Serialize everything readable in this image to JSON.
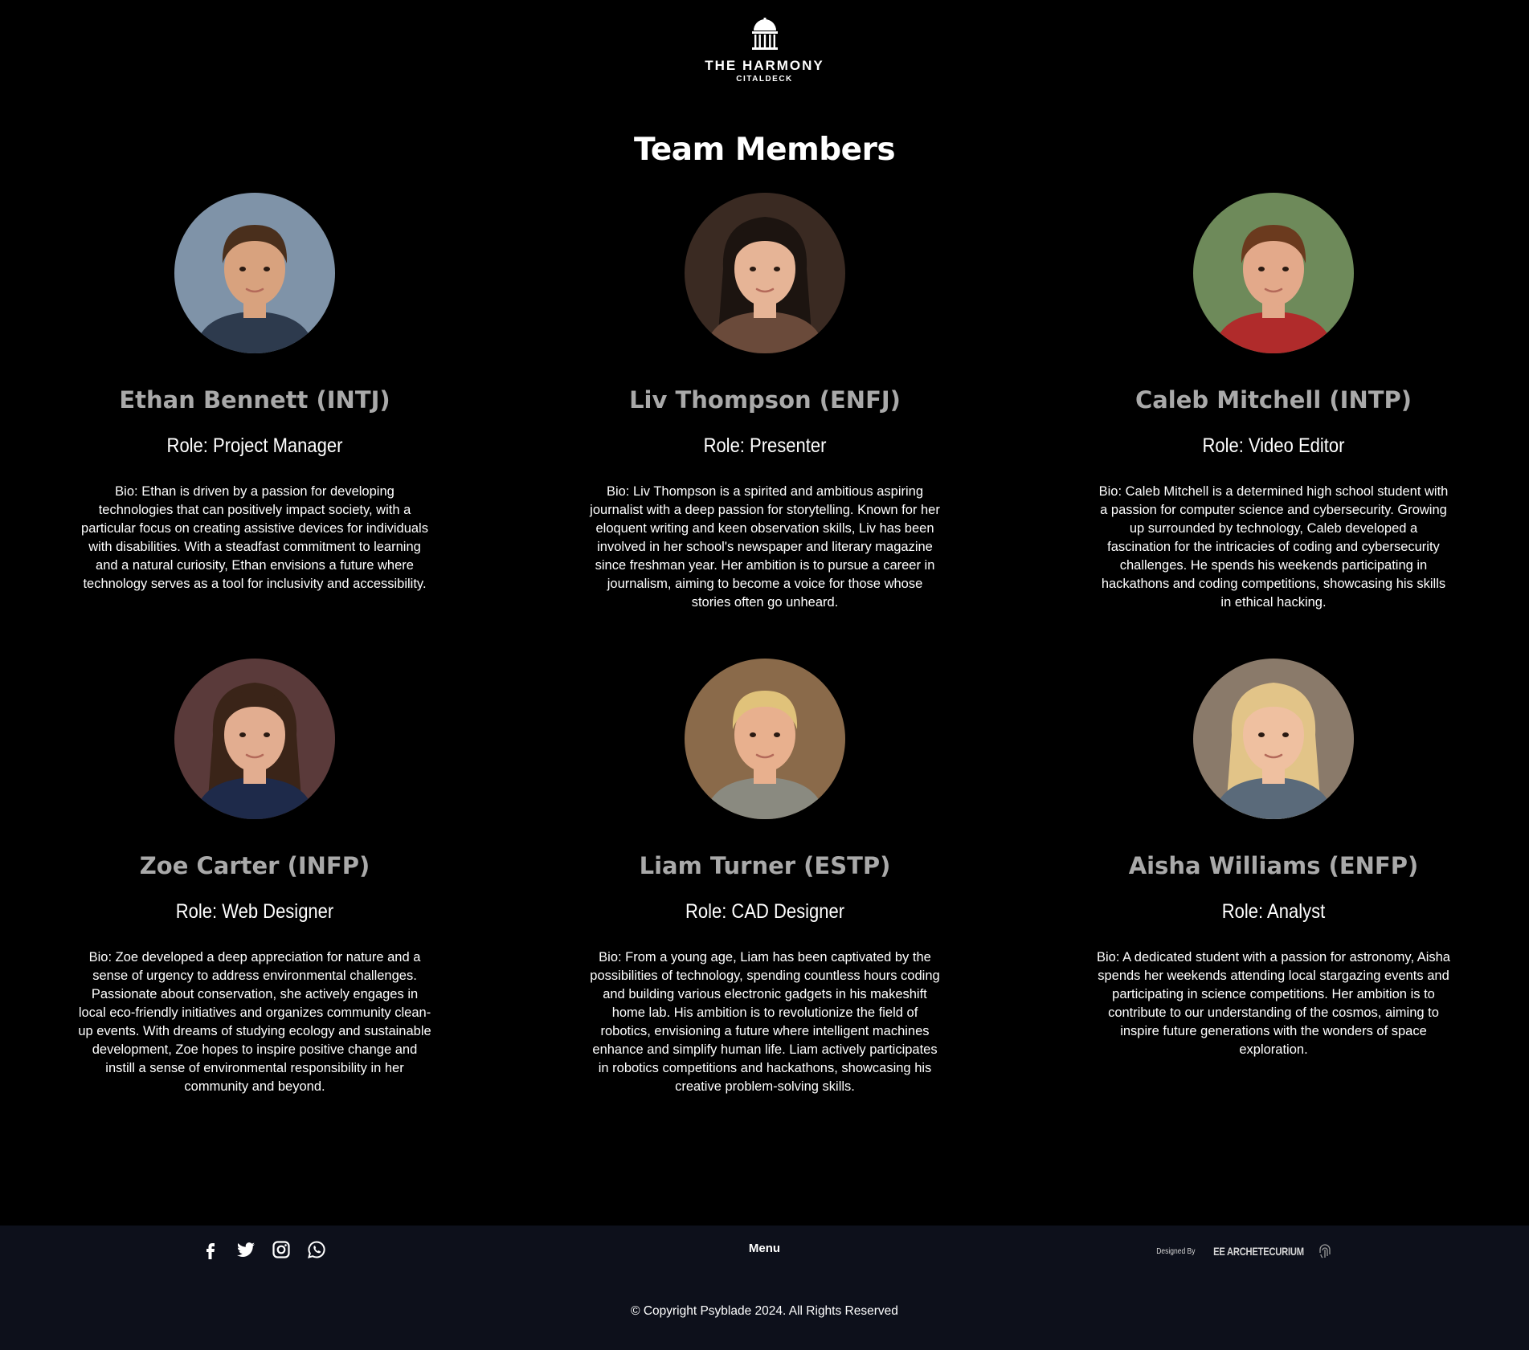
{
  "brand": {
    "name": "THE HARMONY",
    "subname": "CITALDECK"
  },
  "section": {
    "title": "Team Members"
  },
  "members": [
    {
      "name": "Ethan Bennett (INTJ)",
      "role": "Role: Project Manager",
      "bio": "Bio: Ethan is driven by a passion for developing technologies that can positively impact society, with a particular focus on creating assistive devices for individuals with disabilities. With a steadfast commitment to learning and a natural curiosity, Ethan envisions a future where technology serves as a tool for inclusivity and accessibility.",
      "avatar_colors": {
        "bg": "#7f93a8",
        "hair": "#4a2f1c",
        "skin": "#d8a27e",
        "shirt": "#2d3a4d"
      }
    },
    {
      "name": "Liv Thompson (ENFJ)",
      "role": "Role: Presenter",
      "bio": "Bio: Liv Thompson is a spirited and ambitious aspiring journalist with a deep passion for storytelling. Known for her eloquent writing and keen observation skills, Liv has been involved in her school's newspaper and literary magazine since freshman year. Her ambition is to pursue a career in journalism, aiming to become a voice for those whose stories often go unheard.",
      "avatar_colors": {
        "bg": "#3a2a22",
        "hair": "#1c1410",
        "skin": "#e6b496",
        "shirt": "#6a4a3a"
      }
    },
    {
      "name": "Caleb Mitchell (INTP)",
      "role": "Role: Video Editor",
      "bio": "Bio: Caleb Mitchell is a determined high school student with a passion for computer science and cybersecurity. Growing up surrounded by technology, Caleb developed a fascination for the intricacies of coding and cybersecurity challenges. He spends his weekends participating in hackathons and coding competitions, showcasing his skills in ethical hacking.",
      "avatar_colors": {
        "bg": "#6e8a5a",
        "hair": "#6b3a1e",
        "skin": "#e3a98a",
        "shirt": "#b02b2b"
      }
    },
    {
      "name": "Zoe Carter (INFP)",
      "role": "Role: Web Designer",
      "bio": "Bio: Zoe developed a deep appreciation for nature and a sense of urgency to address environmental challenges. Passionate about conservation, she actively engages in local eco-friendly initiatives and organizes community clean-up events. With dreams of studying ecology and sustainable development, Zoe hopes to inspire positive change and instill a sense of environmental responsibility in her community and beyond.",
      "avatar_colors": {
        "bg": "#5a3a3a",
        "hair": "#3a2418",
        "skin": "#e2ad90",
        "shirt": "#1e2a4a"
      }
    },
    {
      "name": "Liam Turner (ESTP)",
      "role": "Role: CAD Designer",
      "bio": "Bio: From a young age, Liam has been captivated by the possibilities of technology, spending countless hours coding and building various electronic gadgets in his makeshift home lab. His ambition is to revolutionize the field of robotics, envisioning a future where intelligent machines enhance and simplify human life. Liam actively participates in robotics competitions and hackathons, showcasing his creative problem-solving skills.",
      "avatar_colors": {
        "bg": "#8a6a4a",
        "hair": "#e0c27a",
        "skin": "#e8b08e",
        "shirt": "#8a8a80"
      }
    },
    {
      "name": "Aisha Williams (ENFP)",
      "role": "Role: Analyst",
      "bio": "Bio: A dedicated student with a passion for astronomy, Aisha spends her weekends attending local stargazing events and participating in science competitions. Her ambition is to contribute to our understanding of the cosmos, aiming to inspire future generations with the wonders of space exploration.",
      "avatar_colors": {
        "bg": "#8a7a6a",
        "hair": "#e2c488",
        "skin": "#efc0a0",
        "shirt": "#5a6a7a"
      }
    }
  ],
  "footer": {
    "menu_label": "Menu",
    "social": [
      "facebook-icon",
      "twitter-icon",
      "instagram-icon",
      "whatsapp-icon"
    ],
    "designed_by": "Designed By",
    "designer": "EE ARCHETECURIUM",
    "copyright": "© Copyright Psyblade 2024. All Rights Reserved",
    "background": "#0d101b"
  },
  "colors": {
    "page_bg": "#000000",
    "name_text": "#a9a9a9",
    "body_text": "#ffffff"
  }
}
